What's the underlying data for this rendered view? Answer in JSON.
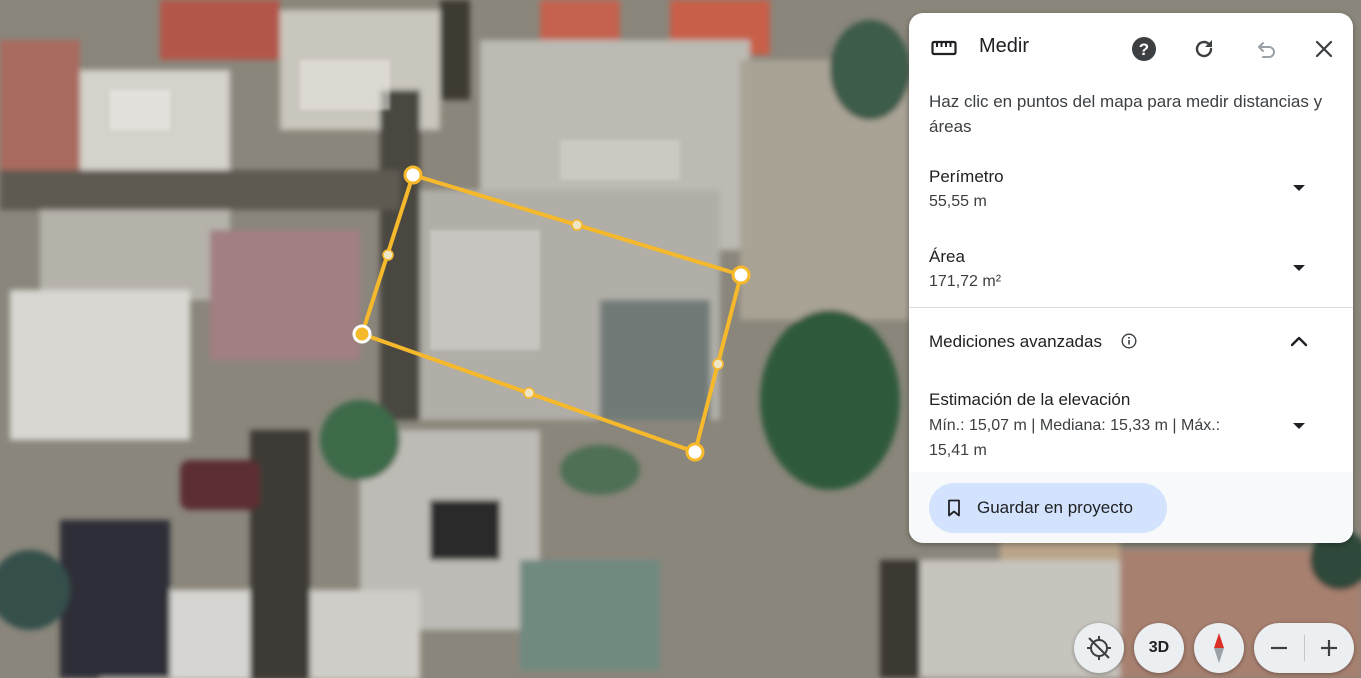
{
  "map": {
    "type": "satellite",
    "measure_shape": "polygon"
  },
  "panel": {
    "title": "Medir",
    "icons": {
      "ruler": "ruler-icon",
      "help": "help-icon",
      "redo": "redo-icon",
      "undo": "undo-icon",
      "close": "close-icon"
    },
    "hint": "Haz clic en puntos del mapa para medir distancias y áreas",
    "perimeter": {
      "label": "Perímetro",
      "value": "55,55 m"
    },
    "area": {
      "label": "Área",
      "value": "171,72 m²"
    },
    "advanced": {
      "label": "Mediciones avanzadas"
    },
    "elevation": {
      "label": "Estimación de la elevación",
      "value": "Mín.: 15,07 m | Mediana: 15,33 m | Máx.: 15,41 m"
    },
    "save_button": "Guardar en proyecto"
  },
  "controls": {
    "view_3d": "3D",
    "icons": [
      "recenter-icon",
      "compass-icon",
      "zoom-out-icon",
      "zoom-in-icon"
    ]
  },
  "colors": {
    "measure_line": "#f6b92b",
    "save_button_bg": "#d3e3fd",
    "compass_red": "#d93025"
  }
}
